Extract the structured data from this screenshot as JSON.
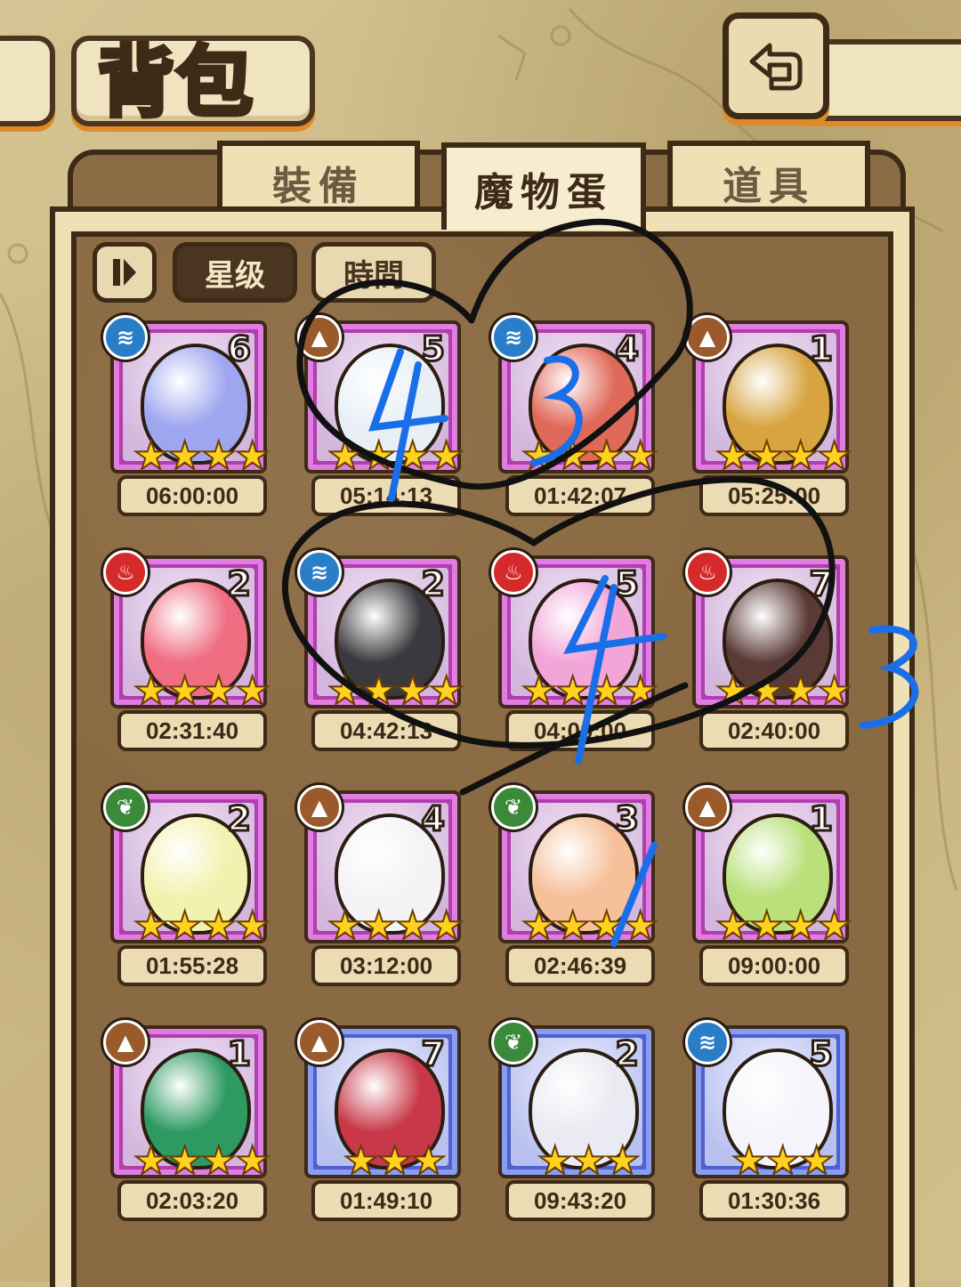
{
  "header": {
    "title": "背包",
    "back_icon": "return-arrow-icon"
  },
  "tabs": [
    {
      "label": "裝備",
      "active": false
    },
    {
      "label": "魔物蛋",
      "active": true
    },
    {
      "label": "道具",
      "active": false
    }
  ],
  "filters": {
    "sort_icon": "sort-toggle-icon",
    "star_label": "星级",
    "time_label": "時間"
  },
  "eggs": [
    {
      "element": "water",
      "count": "6",
      "stars": 4,
      "timer": "06:00:00",
      "frame": "pink",
      "color": "#9ea6f0"
    },
    {
      "element": "earth",
      "count": "5",
      "stars": 4,
      "timer": "05:14:13",
      "frame": "pink",
      "color": "#e8f0f6"
    },
    {
      "element": "water",
      "count": "4",
      "stars": 4,
      "timer": "01:42:07",
      "frame": "pink",
      "color": "#e06a5a"
    },
    {
      "element": "earth",
      "count": "1",
      "stars": 4,
      "timer": "05:25:00",
      "frame": "pink",
      "color": "#d8a440"
    },
    {
      "element": "fire",
      "count": "2",
      "stars": 4,
      "timer": "02:31:40",
      "frame": "pink",
      "color": "#f06d82"
    },
    {
      "element": "water",
      "count": "2",
      "stars": 4,
      "timer": "04:42:13",
      "frame": "pink",
      "color": "#3a3a3e"
    },
    {
      "element": "fire",
      "count": "5",
      "stars": 4,
      "timer": "04:00:00",
      "frame": "pink",
      "color": "#f2a6d8"
    },
    {
      "element": "fire",
      "count": "7",
      "stars": 4,
      "timer": "02:40:00",
      "frame": "pink",
      "color": "#5a3a36"
    },
    {
      "element": "leaf",
      "count": "2",
      "stars": 4,
      "timer": "01:55:28",
      "frame": "pink",
      "color": "#f2f2b0"
    },
    {
      "element": "earth",
      "count": "4",
      "stars": 4,
      "timer": "03:12:00",
      "frame": "pink",
      "color": "#f4f4f6"
    },
    {
      "element": "leaf",
      "count": "3",
      "stars": 4,
      "timer": "02:46:39",
      "frame": "pink",
      "color": "#f6c09a"
    },
    {
      "element": "earth",
      "count": "1",
      "stars": 4,
      "timer": "09:00:00",
      "frame": "pink",
      "color": "#b9e07a"
    },
    {
      "element": "earth",
      "count": "1",
      "stars": 4,
      "timer": "02:03:20",
      "frame": "pink",
      "color": "#2e9a62"
    },
    {
      "element": "earth",
      "count": "7",
      "stars": 3,
      "timer": "01:49:10",
      "frame": "blue",
      "color": "#c83848"
    },
    {
      "element": "leaf",
      "count": "2",
      "stars": 3,
      "timer": "09:43:20",
      "frame": "blue",
      "color": "#eaeaf2"
    },
    {
      "element": "water",
      "count": "5",
      "stars": 3,
      "timer": "01:30:36",
      "frame": "blue",
      "color": "#f4f4fa"
    }
  ],
  "annotations": {
    "handwritten_numbers": [
      "4",
      "3",
      "4",
      "3",
      "1"
    ],
    "ink_colors": {
      "black": "#111111",
      "blue": "#1a6ee8"
    }
  }
}
